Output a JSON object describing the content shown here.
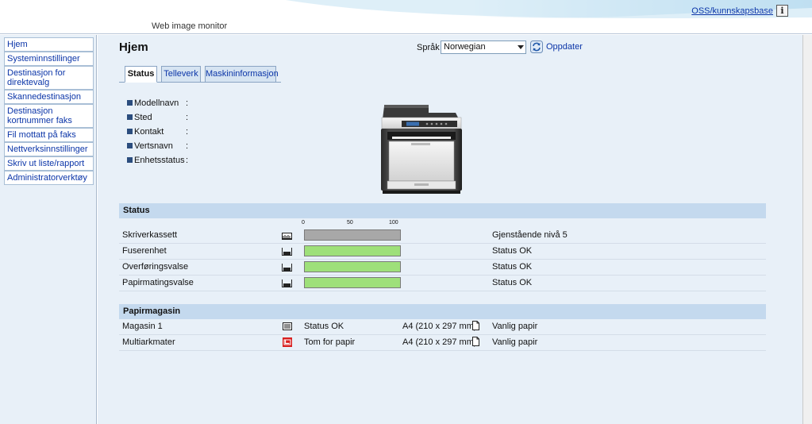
{
  "header": {
    "app_title": "Web image monitor",
    "help_link": "OSS/kunnskapsbase",
    "help_icon": "i"
  },
  "sidebar": {
    "items": [
      {
        "label": "Hjem"
      },
      {
        "label": "Systeminnstillinger"
      },
      {
        "label": "Destinasjon for direktevalg"
      },
      {
        "label": "Skannedestinasjon"
      },
      {
        "label": "Destinasjon kortnummer faks"
      },
      {
        "label": "Fil mottatt på faks"
      },
      {
        "label": "Nettverksinnstillinger"
      },
      {
        "label": "Skriv ut liste/rapport"
      },
      {
        "label": "Administratorverktøy"
      }
    ]
  },
  "main": {
    "title": "Hjem",
    "language_label": "Språk",
    "language_value": "Norwegian",
    "refresh_label": "Oppdater",
    "tabs": [
      {
        "label": "Status",
        "active": true
      },
      {
        "label": "Telleverk",
        "active": false
      },
      {
        "label": "Maskininformasjon",
        "active": false
      }
    ],
    "info": [
      {
        "label": "Modellnavn",
        "value": ""
      },
      {
        "label": "Sted",
        "value": ""
      },
      {
        "label": "Kontakt",
        "value": ""
      },
      {
        "label": "Vertsnavn",
        "value": ""
      },
      {
        "label": "Enhetsstatus",
        "value": ""
      }
    ],
    "info_separator": ":"
  },
  "status_section": {
    "title": "Status",
    "scale": [
      "0",
      "50",
      "100"
    ],
    "rows": [
      {
        "name": "Skriverkassett",
        "level_percent": 100,
        "bar_color": "#a8a8a8",
        "message": "Gjenstående nivå 5"
      },
      {
        "name": "Fuserenhet",
        "level_percent": 100,
        "bar_color": "#9ee07a",
        "message": "Status OK"
      },
      {
        "name": "Overføringsvalse",
        "level_percent": 100,
        "bar_color": "#9ee07a",
        "message": "Status OK"
      },
      {
        "name": "Papirmatingsvalse",
        "level_percent": 100,
        "bar_color": "#9ee07a",
        "message": "Status OK"
      }
    ]
  },
  "paper_section": {
    "title": "Papirmagasin",
    "rows": [
      {
        "name": "Magasin 1",
        "status": "Status OK",
        "size": "A4 (210 x 297 mm)",
        "type": "Vanlig papir",
        "icon": "tray-ok-icon"
      },
      {
        "name": "Multiarkmater",
        "status": "Tom for papir",
        "size": "A4 (210 x 297 mm)",
        "type": "Vanlig papir",
        "icon": "tray-empty-icon"
      }
    ]
  },
  "colors": {
    "link": "#0b35a8",
    "section_header": "#c4d9ee",
    "background": "#e8f0f8",
    "ok_bar": "#9ee07a",
    "toner_bar": "#a8a8a8",
    "empty_alert": "#d82020"
  }
}
